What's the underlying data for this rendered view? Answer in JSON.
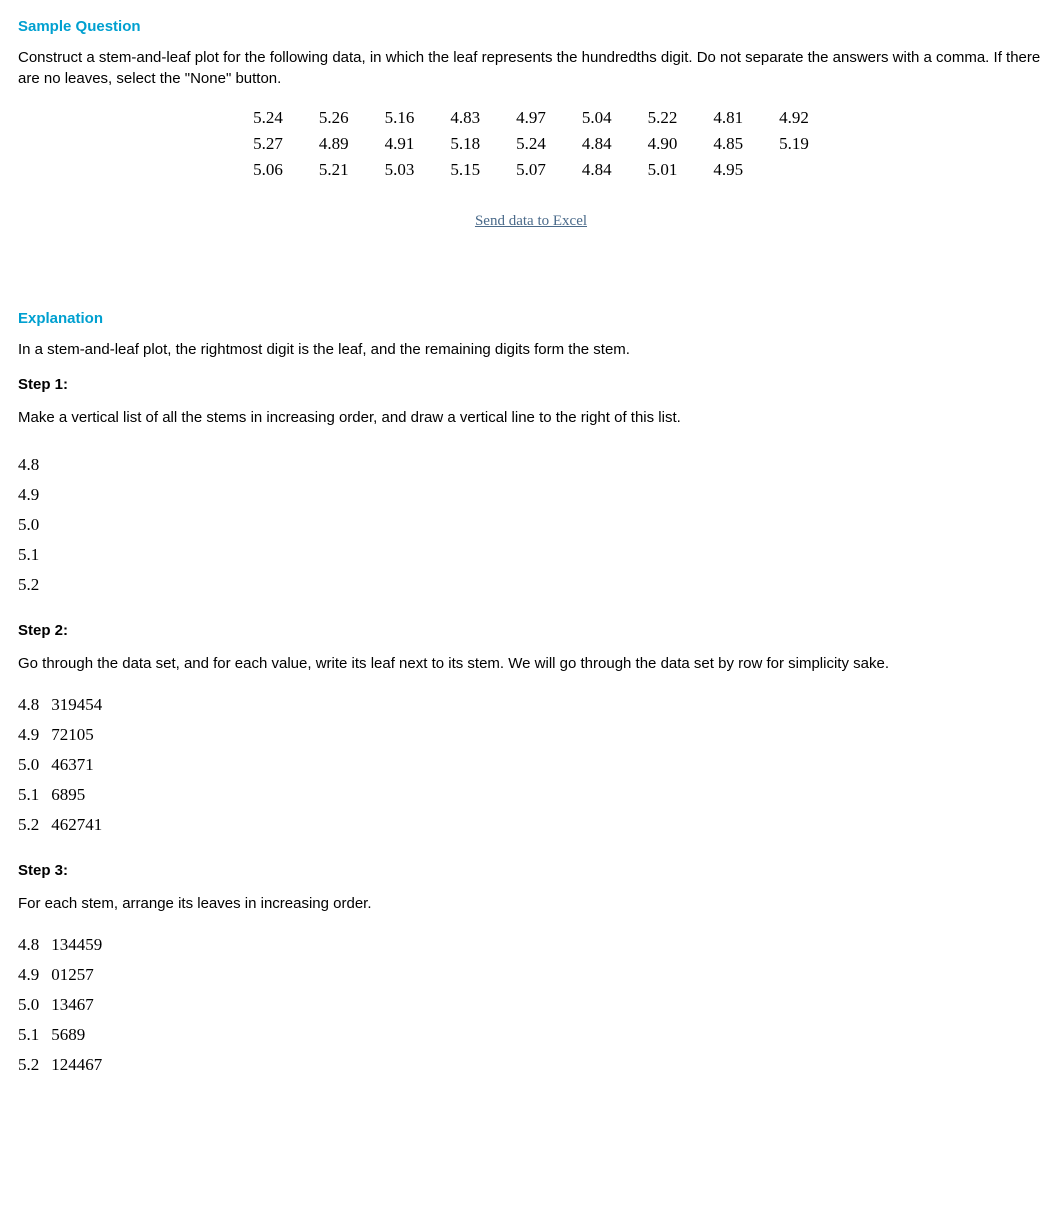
{
  "question": {
    "heading": "Sample Question",
    "prompt": "Construct a stem-and-leaf plot for the following data, in which the leaf represents the hundredths digit. Do not separate the answers with a comma. If there are no leaves, select the \"None\" button.",
    "data_rows": [
      [
        "5.24",
        "5.26",
        "5.16",
        "4.83",
        "4.97",
        "5.04",
        "5.22",
        "4.81",
        "4.92"
      ],
      [
        "5.27",
        "4.89",
        "4.91",
        "5.18",
        "5.24",
        "4.84",
        "4.90",
        "4.85",
        "5.19"
      ],
      [
        "5.06",
        "5.21",
        "5.03",
        "5.15",
        "5.07",
        "4.84",
        "5.01",
        "4.95",
        ""
      ]
    ],
    "excel_link": "Send data to Excel"
  },
  "explanation": {
    "heading": "Explanation",
    "intro": "In a stem-and-leaf plot, the rightmost digit is the leaf, and the remaining digits form the stem.",
    "step1": {
      "label": "Step 1:",
      "text": "Make a vertical list of all the stems in increasing order, and draw a vertical line to the right of this list.",
      "stems": [
        "4.8",
        "4.9",
        "5.0",
        "5.1",
        "5.2"
      ]
    },
    "step2": {
      "label": "Step 2:",
      "text": "Go through the data set, and for each value, write its leaf next to its stem. We will go through the data set by row for simplicity sake.",
      "rows": [
        {
          "stem": "4.8",
          "leaves": "319454"
        },
        {
          "stem": "4.9",
          "leaves": "72105"
        },
        {
          "stem": "5.0",
          "leaves": "46371"
        },
        {
          "stem": "5.1",
          "leaves": "6895"
        },
        {
          "stem": "5.2",
          "leaves": "462741"
        }
      ]
    },
    "step3": {
      "label": "Step 3:",
      "text": "For each stem, arrange its leaves in increasing order.",
      "rows": [
        {
          "stem": "4.8",
          "leaves": "134459"
        },
        {
          "stem": "4.9",
          "leaves": "01257"
        },
        {
          "stem": "5.0",
          "leaves": "13467"
        },
        {
          "stem": "5.1",
          "leaves": "5689"
        },
        {
          "stem": "5.2",
          "leaves": "124467"
        }
      ]
    }
  }
}
